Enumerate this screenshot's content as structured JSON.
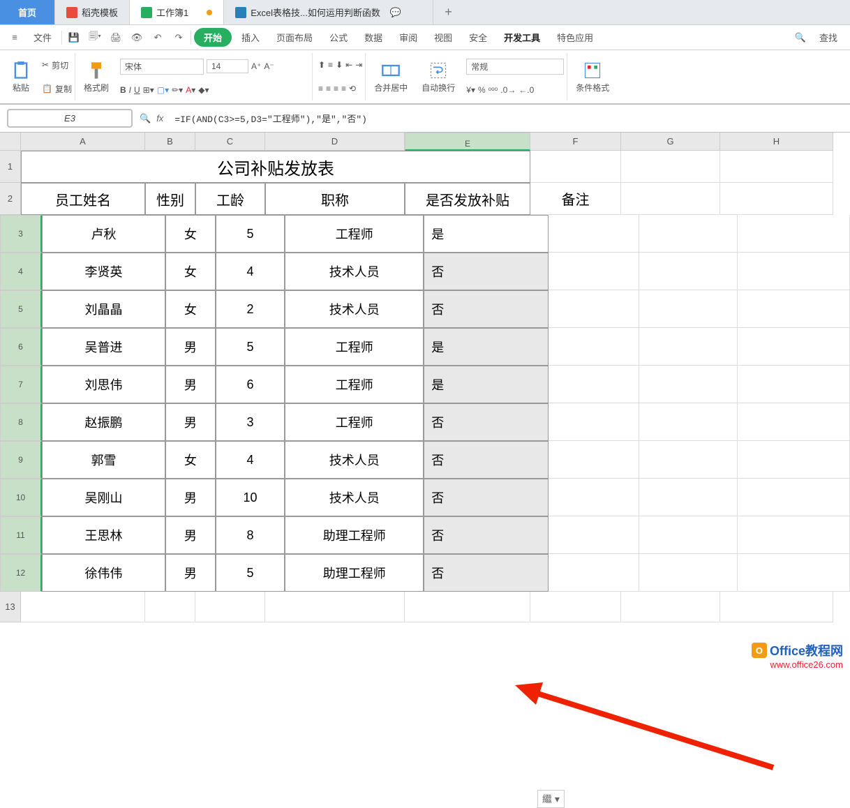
{
  "tabs": {
    "home": "首页",
    "docer": "稻壳模板",
    "workbook": "工作簿1",
    "article": "Excel表格技...如何运用判断函数"
  },
  "menu": {
    "file": "文件",
    "start": "开始",
    "insert": "插入",
    "layout": "页面布局",
    "formula": "公式",
    "data": "数据",
    "review": "审阅",
    "view": "视图",
    "security": "安全",
    "dev": "开发工具",
    "special": "特色应用",
    "find": "查找"
  },
  "toolbar": {
    "paste": "粘贴",
    "cut": "剪切",
    "copy": "复制",
    "format_painter": "格式刷",
    "font": "宋体",
    "font_size": "14",
    "merge": "合并居中",
    "wrap": "自动换行",
    "number_format": "常规",
    "cond_format": "条件格式"
  },
  "cell_ref": "E3",
  "formula": "=IF(AND(C3>=5,D3=\"工程师\"),\"是\",\"否\")",
  "columns": [
    "A",
    "B",
    "C",
    "D",
    "E",
    "F",
    "G",
    "H"
  ],
  "title": "公司补贴发放表",
  "headers": {
    "a": "员工姓名",
    "b": "性别",
    "c": "工龄",
    "d": "职称",
    "e": "是否发放补贴",
    "f": "备注"
  },
  "rows": [
    {
      "a": "卢秋",
      "b": "女",
      "c": "5",
      "d": "工程师",
      "e": "是"
    },
    {
      "a": "李贤英",
      "b": "女",
      "c": "4",
      "d": "技术人员",
      "e": "否"
    },
    {
      "a": "刘晶晶",
      "b": "女",
      "c": "2",
      "d": "技术人员",
      "e": "否"
    },
    {
      "a": "吴普进",
      "b": "男",
      "c": "5",
      "d": "工程师",
      "e": "是"
    },
    {
      "a": "刘思伟",
      "b": "男",
      "c": "6",
      "d": "工程师",
      "e": "是"
    },
    {
      "a": "赵振鹏",
      "b": "男",
      "c": "3",
      "d": "工程师",
      "e": "否"
    },
    {
      "a": "郭雪",
      "b": "女",
      "c": "4",
      "d": "技术人员",
      "e": "否"
    },
    {
      "a": "吴刚山",
      "b": "男",
      "c": "10",
      "d": "技术人员",
      "e": "否"
    },
    {
      "a": "王思林",
      "b": "男",
      "c": "8",
      "d": "助理工程师",
      "e": "否"
    },
    {
      "a": "徐伟伟",
      "b": "男",
      "c": "5",
      "d": "助理工程师",
      "e": "否"
    }
  ],
  "watermark": {
    "title": "Office教程网",
    "url": "www.office26.com"
  },
  "autofill": "繼 ▾"
}
